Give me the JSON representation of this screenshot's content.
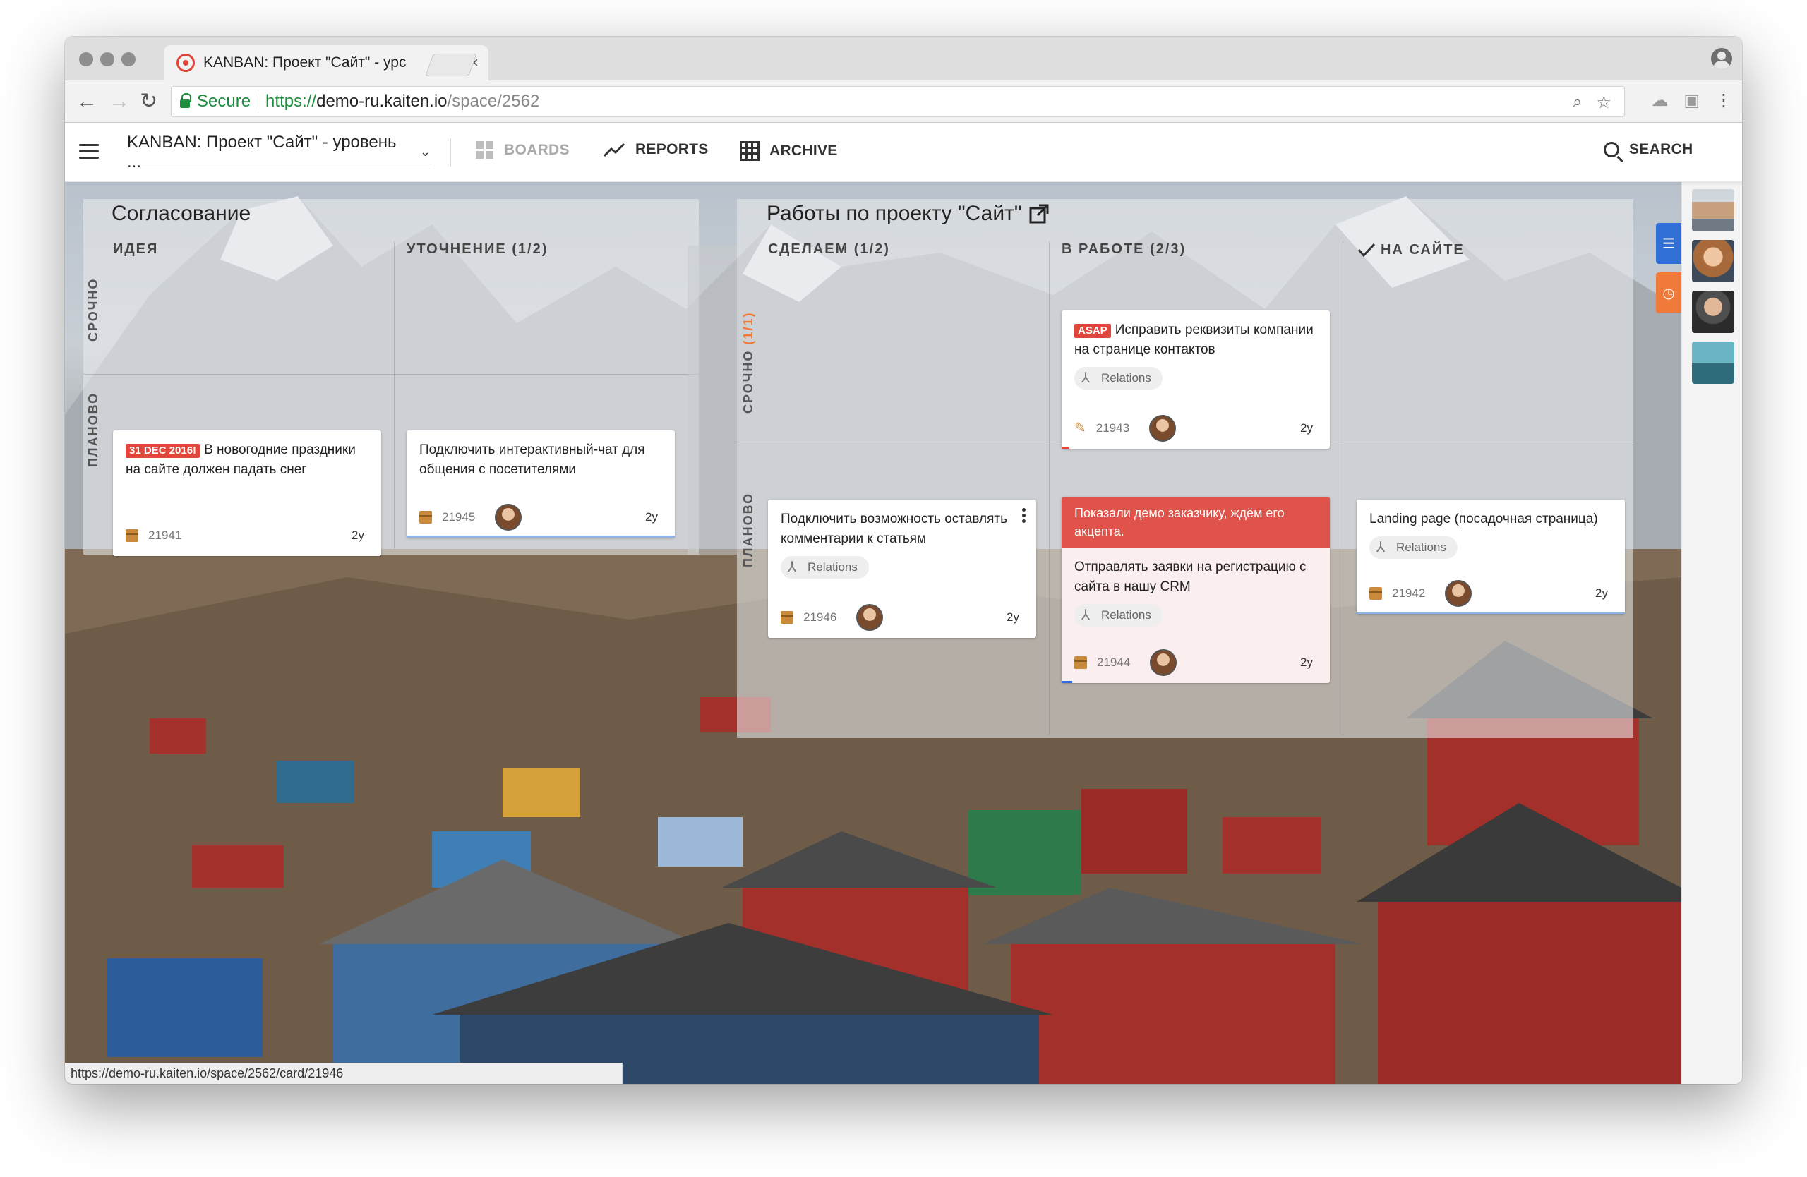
{
  "browser": {
    "tab_title": "KANBAN: Проект \"Сайт\" - урс",
    "tab_close": "×",
    "secure_label": "Secure",
    "url_scheme": "https://",
    "url_host": "demo-ru.kaiten.io",
    "url_path": "/space/2562",
    "status_url": "https://demo-ru.kaiten.io/space/2562/card/21946"
  },
  "header": {
    "space_name": "KANBAN: Проект \"Сайт\" - уровень ...",
    "nav": {
      "boards": "BOARDS",
      "reports": "REPORTS",
      "archive": "ARCHIVE",
      "search": "SEARCH"
    }
  },
  "boards": [
    {
      "title": "Согласование",
      "columns": [
        "ИДЕЯ",
        "УТОЧНЕНИЕ (1/2)"
      ],
      "lanes": [
        "СРОЧНО",
        "ПЛАНОВО"
      ]
    },
    {
      "title": "Работы по проекту \"Сайт\"",
      "columns": [
        "СДЕЛАЕМ (1/2)",
        "В РАБОТЕ (2/3)",
        "НА САЙТЕ"
      ],
      "lanes": [
        "СРОЧНО",
        "(1/1)",
        "ПЛАНОВО"
      ]
    }
  ],
  "cards": {
    "c21941": {
      "tag": "31 DEC 2016!",
      "title": "В новогодние праздники на сайте должен падать снег",
      "id": "21941",
      "age": "2y"
    },
    "c21945": {
      "title": "Подключить интерактивный-чат для общения с посетителями",
      "id": "21945",
      "age": "2y"
    },
    "c21946": {
      "title": "Подключить возможность оставлять комментарии к статьям",
      "relations": "Relations",
      "id": "21946",
      "age": "2y"
    },
    "c21943": {
      "tag": "ASAP",
      "title": "Исправить реквизиты компании на странице контактов",
      "relations": "Relations",
      "id": "21943",
      "age": "2y"
    },
    "c21944": {
      "banner": "Показали демо заказчику, ждём его акцепта.",
      "title": "Отправлять заявки на регистрацию с сайта в нашу CRM",
      "relations": "Relations",
      "id": "21944",
      "age": "2y"
    },
    "c21942": {
      "title": "Landing page (посадочная страница)",
      "relations": "Relations",
      "id": "21942",
      "age": "2y"
    }
  },
  "colors": {
    "accent_red": "#e0463b",
    "accent_blue": "#2f6fd6",
    "accent_orange": "#f07a3a",
    "secure_green": "#1e8e3e"
  },
  "icons": [
    "hamburger-icon",
    "chevron-down-icon",
    "boards-icon",
    "reports-icon",
    "archive-icon",
    "search-icon",
    "external-link-icon",
    "check-icon",
    "filter-icon",
    "timer-icon",
    "relations-icon",
    "box-icon",
    "pin-icon",
    "more-vertical-icon"
  ]
}
